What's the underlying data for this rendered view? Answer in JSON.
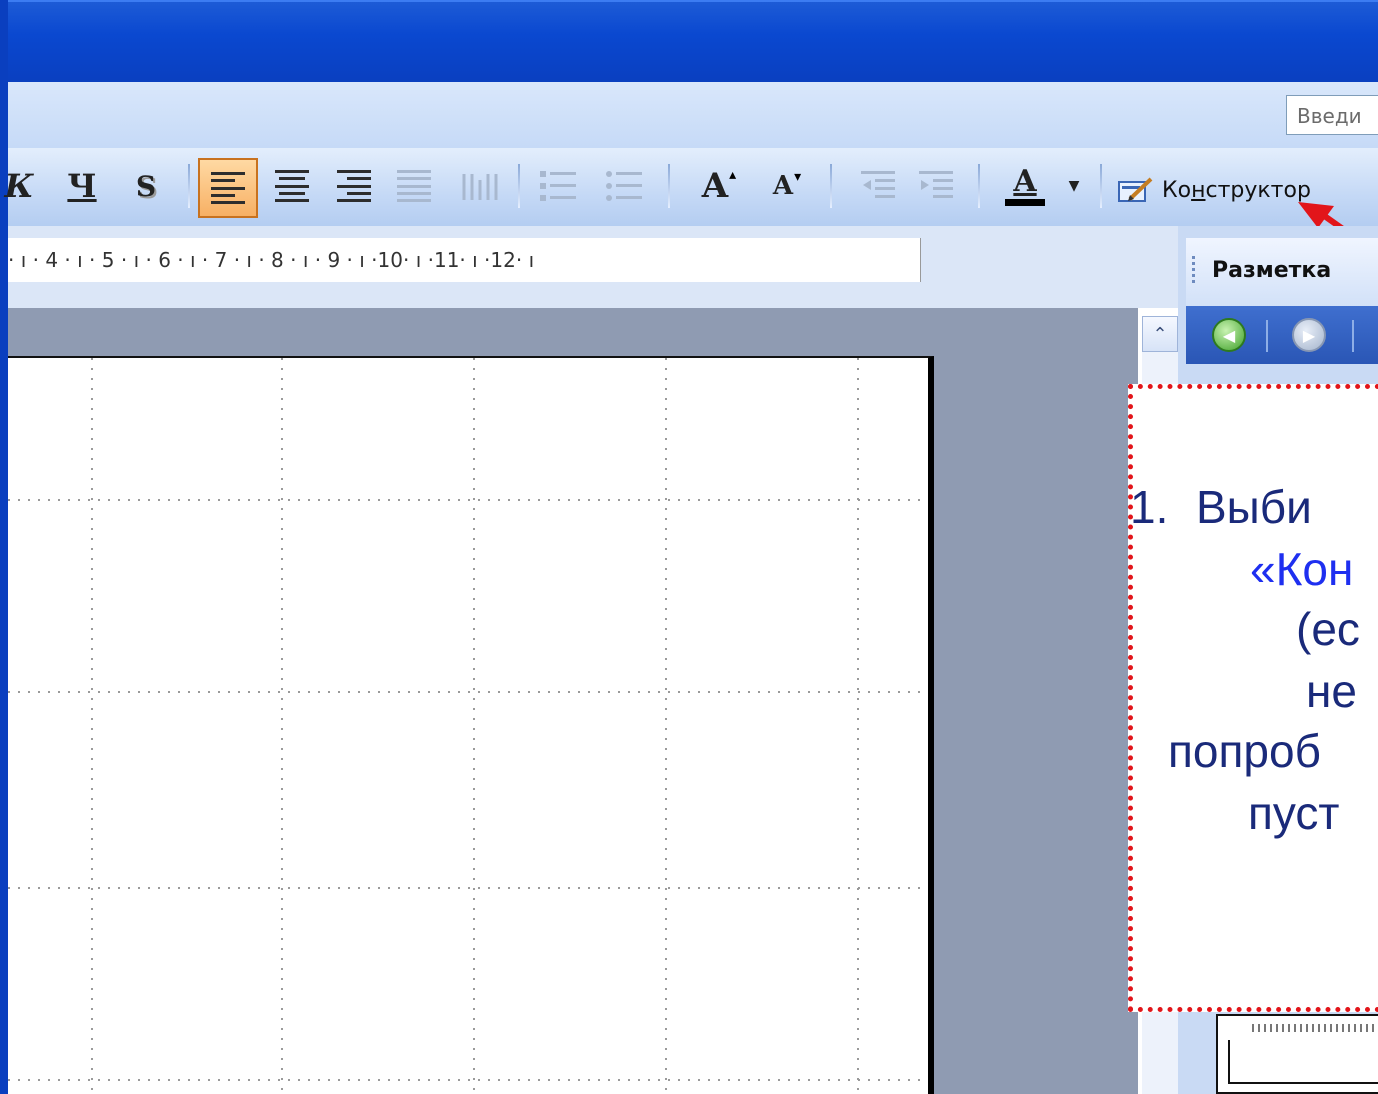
{
  "window": {
    "title": ""
  },
  "menubar": {
    "help_box_text": "Введи"
  },
  "toolbar": {
    "italic_label": "К",
    "underline_label": "Ч",
    "shadow_label": "S",
    "font_grow_label": "A",
    "font_shrink_label": "A",
    "font_color_label": "A",
    "font_color_swatch": "#000000",
    "designer_label_before": "Ко",
    "designer_label_hotkey": "н",
    "designer_label_after": "структор",
    "active_button_color": "#f7b064"
  },
  "ruler": {
    "text": "· ı · 4 · ı · 5 · ı · 6 · ı · 7 · ı · 8 · ı · 9 · ı ·10· ı ·11· ı ·12· ı"
  },
  "task_pane": {
    "title": "Разметка"
  },
  "callout": {
    "number": "1.",
    "line1": "Выби",
    "line2": "«Кон",
    "line3": "(ес",
    "line4": "не",
    "line5": "попроб",
    "line6": "пуст",
    "border_color": "#e2151a",
    "text_color": "#1a2a7a",
    "highlight_color": "#1e2ff0"
  }
}
